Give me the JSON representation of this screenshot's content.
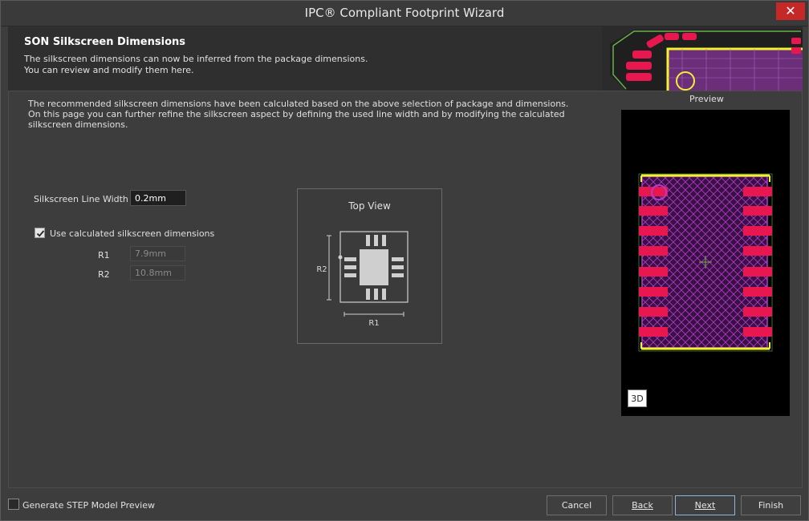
{
  "window": {
    "title": "IPC® Compliant Footprint Wizard",
    "close_glyph": "✕"
  },
  "header": {
    "title": "SON Silkscreen Dimensions",
    "desc_line1": "The silkscreen dimensions can now be inferred from the package dimensions.",
    "desc_line2": "You can review and modify them here."
  },
  "intro": {
    "line1": "The recommended silkscreen dimensions have been calculated based on the above selection of package and dimensions.",
    "line2": "On this page you can further refine the silkscreen aspect by defining the used line width and by modifying the calculated",
    "line3": "silkscreen dimensions."
  },
  "form": {
    "line_width_label": "Silkscreen Line Width",
    "line_width_value": "0.2mm",
    "use_calc_label": "Use calculated silkscreen dimensions",
    "use_calc_checked": true,
    "r1_label": "R1",
    "r1_value": "7.9mm",
    "r2_label": "R2",
    "r2_value": "10.8mm"
  },
  "topview": {
    "title": "Top View",
    "r1": "R1",
    "r2": "R2"
  },
  "preview": {
    "label": "Preview",
    "btn3d": "3D",
    "pad_color": "#e8174f",
    "silk_color": "#f2f230",
    "body_color": "#b03cc8"
  },
  "footer": {
    "step_label": "Generate STEP Model Preview",
    "step_checked": false,
    "cancel": "Cancel",
    "back": "Back",
    "next": "Next",
    "finish": "Finish"
  }
}
